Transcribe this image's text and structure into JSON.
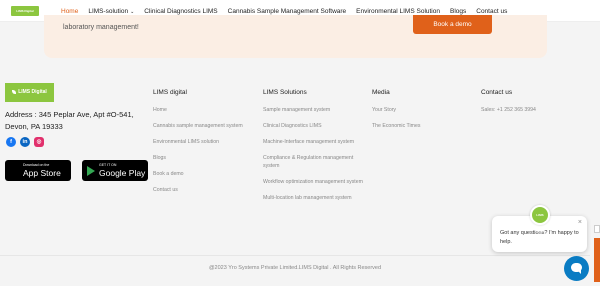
{
  "header": {
    "logo_text": "LIMS Digital",
    "nav": [
      {
        "label": "Home",
        "active": true
      },
      {
        "label": "LIMS-solution",
        "has_caret": true
      },
      {
        "label": "Clinical Diagnostics LIMS"
      },
      {
        "label": "Cannabis Sample Management Software"
      },
      {
        "label": "Environmental LIMS Solution"
      },
      {
        "label": "Blogs"
      },
      {
        "label": "Contact us"
      }
    ]
  },
  "cta": {
    "text": "laboratory management!",
    "button": "Book a demo"
  },
  "footer": {
    "logo_text": "LIMS Digital",
    "address": "Address : 345 Peplar Ave, Apt #O-541, Devon, PA 19333",
    "socials": [
      "f",
      "in",
      "◎"
    ],
    "app_store": {
      "small": "Download on the",
      "big": "App Store"
    },
    "google_play": {
      "small": "GET IT ON",
      "big": "Google Play"
    },
    "columns": [
      {
        "title": "LIMS digital",
        "items": [
          "Home",
          "Cannabis sample management system",
          "Environmental LIMS solution",
          "Blogs",
          "Book a demo",
          "Contact us"
        ]
      },
      {
        "title": "LIMS Solutions",
        "items": [
          "Sample management system",
          "Clinical Diagnostics LIMS",
          "Machine-Interface management system",
          "Compliance & Regulation management system",
          "Workflow optimization management system",
          "Multi-location lab management system"
        ]
      },
      {
        "title": "Media",
        "items": [
          "Your Story",
          "The Economic Times"
        ]
      },
      {
        "title": "Contact us",
        "items": [
          "Sales: +1 252 365 3994"
        ]
      }
    ],
    "copyright": "@2023 Yro Systems Private Limited.LIMS Digital . All Rights Reserved"
  },
  "chat": {
    "avatar_text": "LIMS Digital",
    "message": "Got any questions? I'm happy to help.",
    "close": "×"
  },
  "colors": {
    "accent": "#e0611a",
    "brand_green": "#8cc63f",
    "chat_blue": "#0a7cc3"
  },
  "icons": {
    "facebook": "facebook-icon",
    "linkedin": "linkedin-icon",
    "instagram": "instagram-icon",
    "apple": "apple-icon",
    "google_play": "google-play-icon",
    "chat": "chat-bubble-icon"
  }
}
